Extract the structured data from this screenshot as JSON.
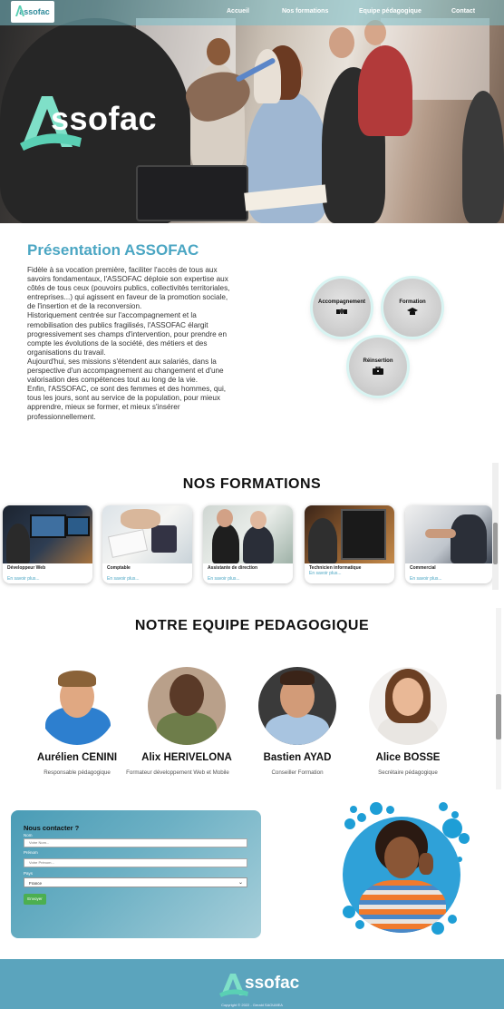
{
  "nav": {
    "logo_text": "assofac",
    "links": [
      "Accueil",
      "Nos formations",
      "Equipe pédagogique",
      "Contact"
    ]
  },
  "hero": {
    "logo_text": "ssofac"
  },
  "presentation": {
    "title": "Présentation ASSOFAC",
    "paragraphs": [
      "Fidèle à sa vocation première, faciliter l'accès de tous aux savoirs fondamentaux, l'ASSOFAC déploie son expertise aux côtés de tous ceux (pouvoirs publics, collectivités territoriales, entreprises...) qui agissent en faveur de la promotion sociale, de l'insertion et de la reconversion.",
      "Historiquement centrée sur l'accompagnement et la remobilisation des publics fragilisés, l'ASSOFAC élargit progressivement ses champs d'intervention, pour prendre en compte les évolutions de la société, des métiers et des organisations du travail.",
      "Aujourd'hui, ses missions s'étendent aux salariés, dans la perspective d'un accompagnement au changement et d'une valorisation des compétences tout au long de la vie.",
      "Enfin, l'ASSOFAC, ce sont des femmes et des hommes, qui, tous les jours, sont au service de la population, pour mieux apprendre, mieux se former, et mieux s'insérer professionnellement."
    ],
    "bubbles": [
      {
        "label": "Accompagnement",
        "icon": "handshake-icon"
      },
      {
        "label": "Formation",
        "icon": "graduation-cap-icon"
      },
      {
        "label": "Réinsertion",
        "icon": "briefcase-icon"
      }
    ]
  },
  "formations": {
    "title": "NOS FORMATIONS",
    "cards": [
      {
        "label": "Développeur Web",
        "link": "En savoir plus..."
      },
      {
        "label": "Comptable",
        "link": "En savoir plus..."
      },
      {
        "label": "Assistante de direction",
        "link": "En savoir plus..."
      },
      {
        "label": "Technicien informatique",
        "link": "En savoir plus..."
      },
      {
        "label": "Commercial",
        "link": "En savoir plus..."
      }
    ]
  },
  "team": {
    "title": "NOTRE EQUIPE PEDAGOGIQUE",
    "members": [
      {
        "name": "Aurélien CENINI",
        "role": "Responsable pédagogique"
      },
      {
        "name": "Alix HERIVELONA",
        "role": "Formateur développement Web et Mobile"
      },
      {
        "name": "Bastien AYAD",
        "role": "Conseiller Formation"
      },
      {
        "name": "Alice BOSSE",
        "role": "Secrétaire pédagogique"
      }
    ]
  },
  "contact": {
    "title": "Nous contacter ?",
    "name_label": "Nom",
    "name_placeholder": "Votre Nom...",
    "firstname_label": "Prénom",
    "firstname_placeholder": "Votre Prénom...",
    "country_label": "Pays",
    "country_value": "France",
    "submit_label": "Envoyer"
  },
  "footer": {
    "logo_text": "ssofac",
    "copyright": "Copyright © 2022 - Gerald SAOUMEA"
  },
  "colors": {
    "accent": "#4ba6c3",
    "footer": "#5ba4bd",
    "submit": "#4caf50"
  }
}
